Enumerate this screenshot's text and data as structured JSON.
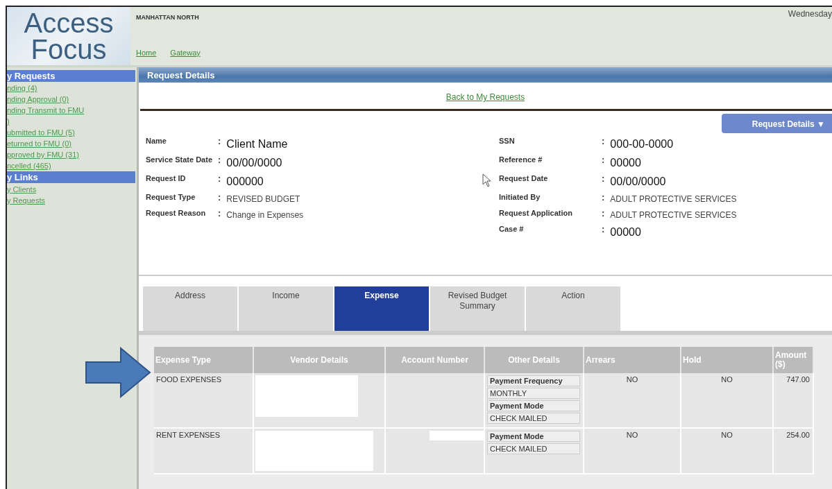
{
  "header": {
    "logo": [
      "Access",
      "Focus"
    ],
    "office": "MANHATTAN NORTH",
    "nav": [
      "Home",
      "Gateway"
    ],
    "date": "Wednesday"
  },
  "sidebar": {
    "sections": [
      {
        "title": "y Requests",
        "links": [
          "nding (4)",
          "nding Approval (0)",
          "nding Transmit to FMU",
          ")",
          "ubmitted to FMU (5)",
          "eturned to FMU (0)",
          "pproved by FMU (31)",
          "ncelled (465)"
        ]
      },
      {
        "title": "y Links",
        "links": [
          "y Clients",
          "y Requests"
        ]
      }
    ]
  },
  "panel": {
    "title": "Request Details",
    "back_link": "Back to My Requests",
    "menu_button": "Request Details ▼",
    "left_fields": [
      {
        "label": "Name",
        "separator": ":",
        "value": "Client Name",
        "kind": "large"
      },
      {
        "label": "Service State Date",
        "separator": ":",
        "value": "00/00/0000",
        "kind": "large"
      },
      {
        "label": "Request ID",
        "separator": ":",
        "value": "000000",
        "kind": "large"
      },
      {
        "label": "Request Type",
        "separator": ":",
        "value": "REVISED BUDGET",
        "kind": "small"
      },
      {
        "label": "Request Reason",
        "separator": ":",
        "value": "Change in Expenses",
        "kind": "small"
      }
    ],
    "right_fields": [
      {
        "label": "SSN",
        "separator": ":",
        "value": "000-00-0000",
        "kind": "large"
      },
      {
        "label": "Reference #",
        "separator": ":",
        "value": "00000",
        "kind": "large"
      },
      {
        "label": "Request Date",
        "separator": ":",
        "value": "00/00/0000",
        "kind": "large"
      },
      {
        "label": "Initiated By",
        "separator": ":",
        "value": "ADULT PROTECTIVE SERVICES",
        "kind": "small"
      },
      {
        "label": "Request Application",
        "separator": ":",
        "value": "ADULT PROTECTIVE SERVICES",
        "kind": "small"
      },
      {
        "label": "Case #",
        "separator": ":",
        "value": "00000",
        "kind": "large"
      }
    ],
    "tabs": [
      {
        "label": "Address",
        "selected": false
      },
      {
        "label": "Income",
        "selected": false
      },
      {
        "label": "Expense",
        "selected": true
      },
      {
        "label": "Revised Budget Summary",
        "selected": false
      },
      {
        "label": "Action",
        "selected": false
      }
    ],
    "table": {
      "columns": [
        "Expense Type",
        "Vendor Details",
        "Account Number",
        "Other Details",
        "Arrears",
        "Hold",
        "Amount ($)"
      ],
      "rows": [
        {
          "expense_type": "FOOD EXPENSES",
          "other_details": [
            {
              "label": "Payment Frequency",
              "value": "MONTHLY"
            },
            {
              "label": "Payment Mode",
              "value": "CHECK MAILED"
            }
          ],
          "arrears": "NO",
          "hold": "NO",
          "amount": "747.00"
        },
        {
          "expense_type": "RENT EXPENSES",
          "other_details": [
            {
              "label": "Payment Mode",
              "value": "CHECK MAILED"
            }
          ],
          "arrears": "NO",
          "hold": "NO",
          "amount": "254.00"
        }
      ]
    }
  }
}
